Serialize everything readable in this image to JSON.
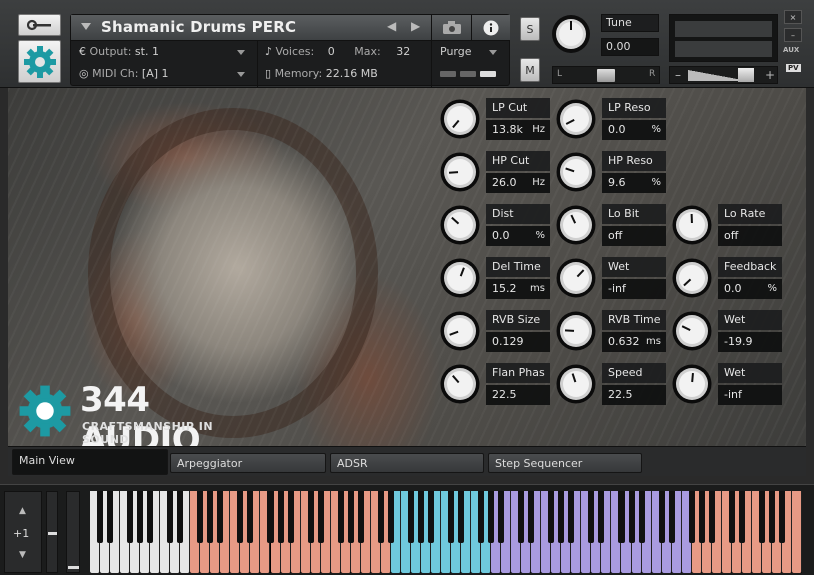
{
  "header": {
    "instrument_name": "Shamanic Drums PERC",
    "output_label": "Output:",
    "output_value": "st. 1",
    "midi_label": "MIDI Ch:",
    "midi_value": "[A]  1",
    "voices_label": "Voices:",
    "voices_value": "0",
    "max_label": "Max:",
    "max_value": "32",
    "memory_label": "Memory:",
    "memory_value": "22.16 MB",
    "purge_label": "Purge",
    "solo_label": "S",
    "mute_label": "M",
    "tune_label": "Tune",
    "tune_value": "0.00",
    "pan_left": "L",
    "pan_right": "R",
    "vol_minus": "–",
    "vol_plus": "+",
    "close_label": "×",
    "minimize_label": "–",
    "aux_label": "AUX",
    "pv_label": "PV"
  },
  "params": [
    {
      "label": "LP Cut",
      "value": "13.8k",
      "unit": "Hz"
    },
    {
      "label": "LP Reso",
      "value": "0.0",
      "unit": "%"
    },
    {
      "label": "HP Cut",
      "value": "26.0",
      "unit": "Hz"
    },
    {
      "label": "HP Reso",
      "value": "9.6",
      "unit": "%"
    },
    {
      "label": "Dist",
      "value": "0.0",
      "unit": "%"
    },
    {
      "label": "Lo Bit",
      "value": "off",
      "unit": ""
    },
    {
      "label": "Lo Rate",
      "value": "off",
      "unit": ""
    },
    {
      "label": "Del Time",
      "value": "15.2",
      "unit": "ms"
    },
    {
      "label": "Wet",
      "value": "-inf",
      "unit": ""
    },
    {
      "label": "Feedback",
      "value": "0.0",
      "unit": "%"
    },
    {
      "label": "RVB Size",
      "value": "0.129",
      "unit": ""
    },
    {
      "label": "RVB Time",
      "value": "0.632",
      "unit": "ms"
    },
    {
      "label": "Wet",
      "value": "-19.9",
      "unit": ""
    },
    {
      "label": "Flan Phas",
      "value": "22.5",
      "unit": ""
    },
    {
      "label": "Speed",
      "value": "22.5",
      "unit": ""
    },
    {
      "label": "Wet",
      "value": "-inf",
      "unit": ""
    }
  ],
  "logo": {
    "name": "344 AUDIO",
    "tagline": "CRAFTSMANSHIP IN SOUND"
  },
  "tabs": [
    {
      "label": "Main View",
      "active": true
    },
    {
      "label": "Arpeggiator",
      "active": false
    },
    {
      "label": "ADSR",
      "active": false
    },
    {
      "label": "Step Sequencer",
      "active": false
    }
  ],
  "keyboard": {
    "octave_shift": "+1",
    "zone_colors": {
      "unmapped": "#e6e6e6",
      "zone1": "#e79a85",
      "zone2": "#6fc9dd",
      "zone3": "#a99be0",
      "zone4": "#e79a85"
    }
  },
  "colors": {
    "accent_teal": "#1d9aa3"
  }
}
